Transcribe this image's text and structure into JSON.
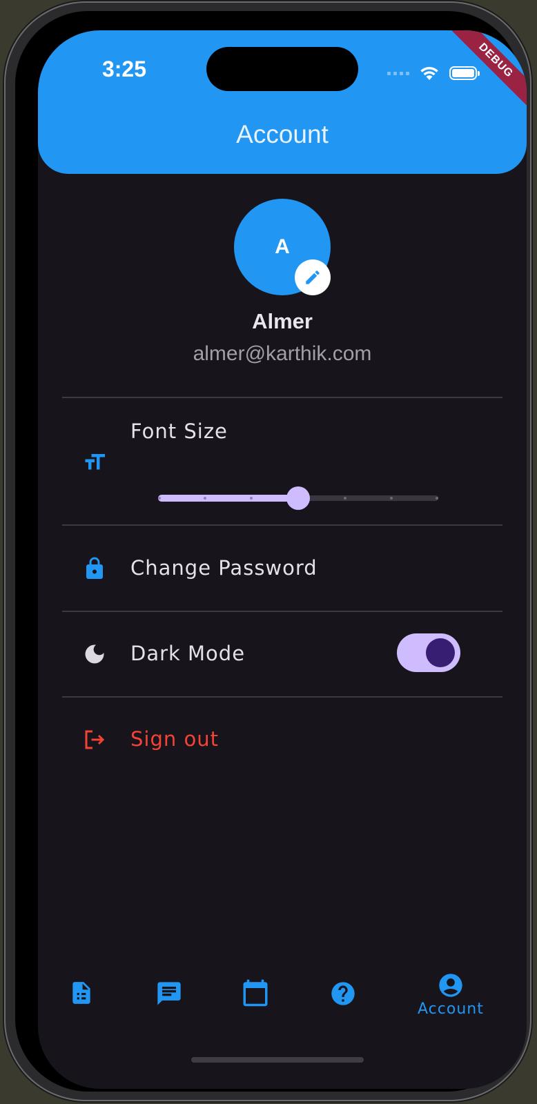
{
  "status_bar": {
    "time": "3:25",
    "debug_ribbon": "DEBUG"
  },
  "app_bar": {
    "title": "Account"
  },
  "profile": {
    "avatar_initial": "A",
    "name": "Almer",
    "email": "almer@karthik.com"
  },
  "settings": {
    "font_size": {
      "label": "Font Size",
      "value_fraction": 0.5,
      "divisions": 6
    },
    "change_password": {
      "label": "Change Password"
    },
    "dark_mode": {
      "label": "Dark Mode",
      "enabled": true
    },
    "sign_out": {
      "label": "Sign out"
    }
  },
  "bottom_nav": {
    "items": [
      {
        "icon": "document-icon"
      },
      {
        "icon": "chat-icon"
      },
      {
        "icon": "calendar-icon"
      },
      {
        "icon": "help-icon"
      },
      {
        "icon": "account-circle-icon",
        "label": "Account",
        "selected": true
      }
    ]
  },
  "colors": {
    "primary": "#2196f3",
    "background": "#17151b",
    "accent": "#cfbcff",
    "accent_dark": "#381e72",
    "danger": "#f44336",
    "divider": "#3d3b42"
  }
}
